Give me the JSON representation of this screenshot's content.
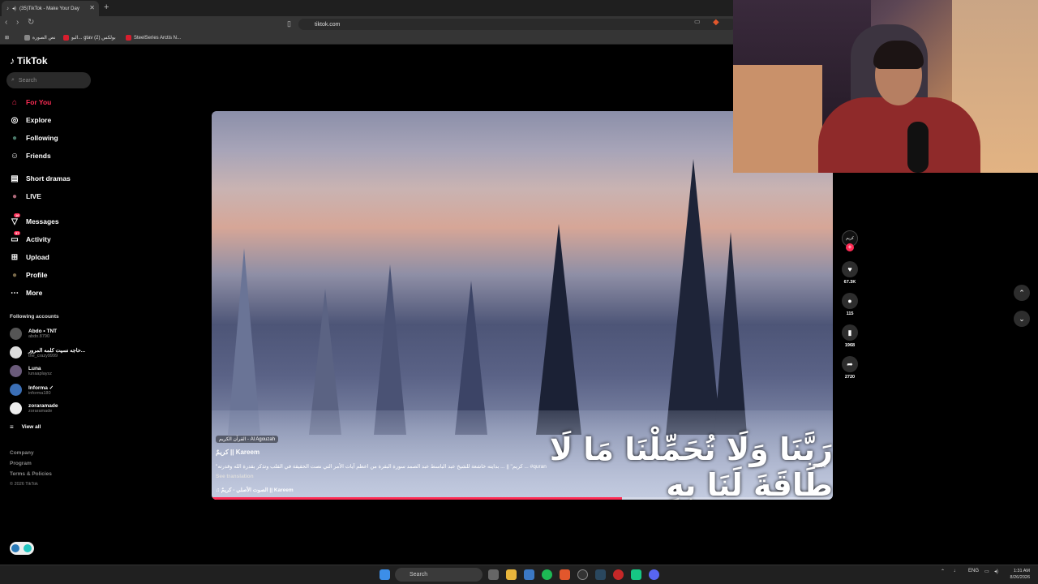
{
  "browser": {
    "tab_title": "(35)TikTok - Make Your Day",
    "tab_close": "✕",
    "new_tab": "+",
    "url": "tiktok.com",
    "bookmarks": [
      {
        "label": "نص الصورة",
        "color": "#888888"
      },
      {
        "label": "البو... gtav بولكس (2)",
        "color": "#d81e2e"
      },
      {
        "label": "SteelSeries Arctis N...",
        "color": "#d81e2e"
      }
    ]
  },
  "tiktok": {
    "logo": "TikTok",
    "search_placeholder": "Search",
    "nav": [
      {
        "label": "For You",
        "icon": "home-icon",
        "glyph": "⌂",
        "badge": ""
      },
      {
        "label": "Explore",
        "icon": "compass-icon",
        "glyph": "◎",
        "badge": ""
      },
      {
        "label": "Following",
        "icon": "following-avatar-icon",
        "glyph": "●",
        "badge": ""
      },
      {
        "label": "Friends",
        "icon": "friends-icon",
        "glyph": "☺",
        "badge": ""
      },
      {
        "label": "Short dramas",
        "icon": "film-icon",
        "glyph": "▤",
        "badge": ""
      },
      {
        "label": "LIVE",
        "icon": "live-avatar-icon",
        "glyph": "●",
        "badge": ""
      },
      {
        "label": "Messages",
        "icon": "messages-icon",
        "glyph": "▽",
        "badge": "16"
      },
      {
        "label": "Activity",
        "icon": "activity-icon",
        "glyph": "▭",
        "badge": "57"
      },
      {
        "label": "Upload",
        "icon": "upload-icon",
        "glyph": "⊞",
        "badge": ""
      },
      {
        "label": "Profile",
        "icon": "profile-avatar-icon",
        "glyph": "●",
        "badge": ""
      },
      {
        "label": "More",
        "icon": "more-icon",
        "glyph": "⋯",
        "badge": ""
      }
    ],
    "following_title": "Following accounts",
    "following": [
      {
        "name": "Abdo • TNT",
        "handle": "abdo.8790"
      },
      {
        "name": "حاجه نسيت كلمه المرور...",
        "handle": "the_crazy9999"
      },
      {
        "name": "Luna",
        "handle": "lunaaplaysz"
      },
      {
        "name": "Informa ✓",
        "handle": "informa180"
      },
      {
        "name": "zoraramade",
        "handle": "zoraramade"
      }
    ],
    "view_all": "View all",
    "footer": [
      "Company",
      "Program",
      "Terms & Policies"
    ],
    "copyright": "© 2026 TikTok"
  },
  "video": {
    "sound_tag": "القرآن الكريم - Al Agouzah",
    "author": "كريمٌ || Kareem",
    "description": "\"كريم\" || ... بدايته خاشعة للشيخ عبد الباسط عبد الصمد سورة البقرة من اعظم آيات الأمر التي نصت الحقيقة في القلب وتذكر بقدرة الله وقدرته ... #quran",
    "see_translation": "See translation",
    "music": "♫  الصوت الأصلي - كريمٌ || Kareem",
    "more": "more",
    "caption_arabic": "رَبَّنَا وَلَا تُحَمِّلْنَا مَا لَا طَاقَةَ لَنَا بِهِ",
    "progress": 0.66
  },
  "actions": {
    "avatar_label": "كريم",
    "likes": "67.3K",
    "comments": "115",
    "saves": "1968",
    "shares": "2720"
  },
  "taskbar": {
    "search": "Search",
    "lang": "ENG",
    "time": "1:31 AM",
    "date": "8/26/2026"
  }
}
